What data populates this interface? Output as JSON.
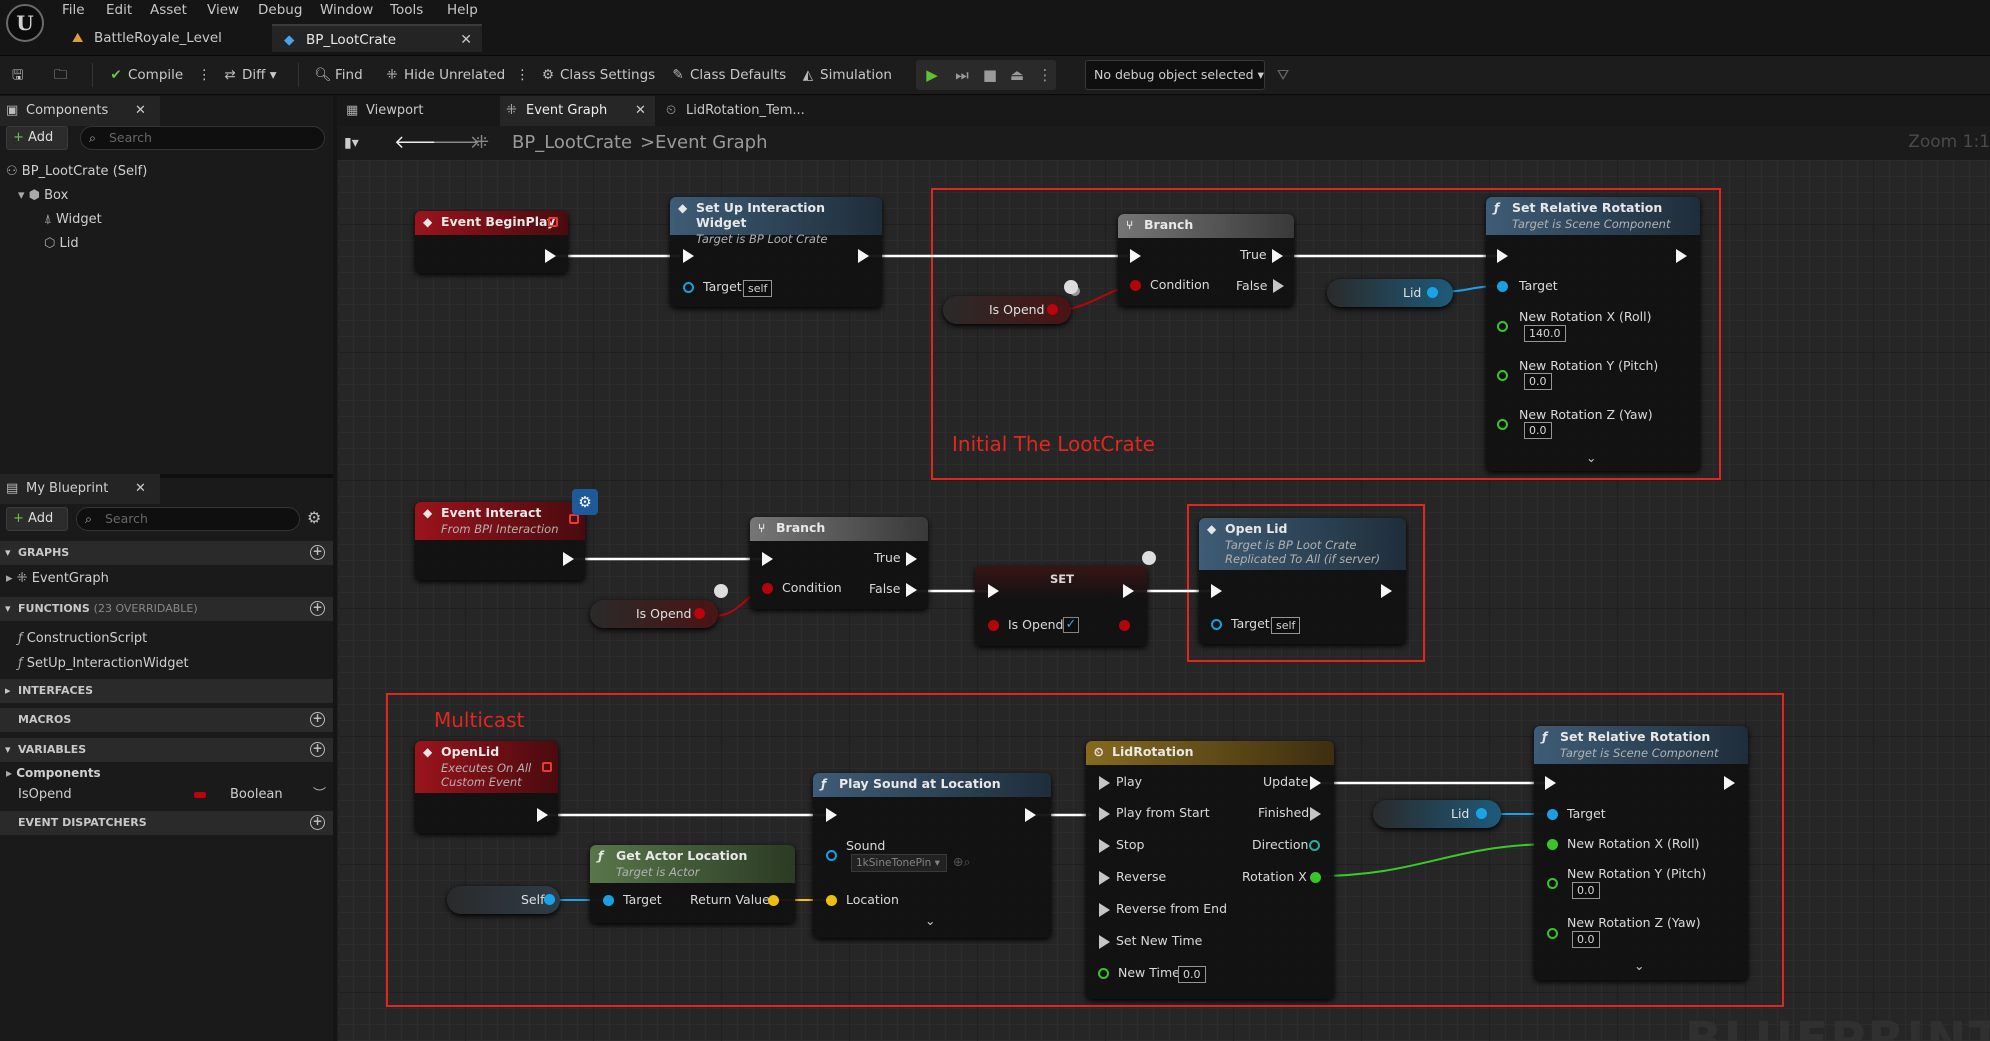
{
  "menu": [
    "File",
    "Edit",
    "Asset",
    "View",
    "Debug",
    "Window",
    "Tools",
    "Help"
  ],
  "doc_tabs": [
    {
      "label": "BattleRoyale_Level"
    },
    {
      "label": "BP_LootCrate"
    }
  ],
  "toolbar": {
    "compile": "Compile",
    "diff": "Diff",
    "find": "Find",
    "hide_unrelated": "Hide Unrelated",
    "class_settings": "Class Settings",
    "class_defaults": "Class Defaults",
    "simulation": "Simulation",
    "debug_select": "No debug object selected"
  },
  "components": {
    "title": "Components",
    "add": "Add",
    "search_placeholder": "Search",
    "items": [
      "BP_LootCrate (Self)",
      "Box",
      "Widget",
      "Lid"
    ]
  },
  "my_blueprint": {
    "title": "My Blueprint",
    "add": "Add",
    "search_placeholder": "Search",
    "sections": {
      "graphs": "GRAPHS",
      "functions": "FUNCTIONS",
      "functions_count": "(23 OVERRIDABLE)",
      "interfaces": "INTERFACES",
      "macros": "MACROS",
      "variables": "VARIABLES",
      "dispatchers": "EVENT DISPATCHERS"
    },
    "graphs": [
      "EventGraph"
    ],
    "functions": [
      "ConstructionScript",
      "SetUp_InteractionWidget"
    ],
    "var_group": "Components",
    "var_name": "IsOpend",
    "var_type": "Boolean"
  },
  "graph_tabs": [
    "Viewport",
    "Event Graph",
    "LidRotation_Tem..."
  ],
  "breadcrumb": {
    "root": "BP_LootCrate",
    "sep": ">",
    "leaf": "Event Graph"
  },
  "zoom": "Zoom 1:1",
  "watermark": "BLUEPRINT",
  "comments": [
    "Initial The LootCrate",
    "Multicast"
  ],
  "nodes": {
    "begin_play": {
      "title": "Event BeginPlay"
    },
    "setup_widget": {
      "title": "Set Up Interaction Widget",
      "sub": "Target is BP Loot Crate",
      "target": "Target",
      "target_val": "self"
    },
    "branch1": {
      "title": "Branch",
      "true": "True",
      "false": "False",
      "cond": "Condition"
    },
    "isopend1": "Is Opend",
    "lid1": "Lid",
    "setrot1": {
      "title": "Set Relative Rotation",
      "sub": "Target is Scene Component",
      "target": "Target",
      "rx": "New Rotation X (Roll)",
      "rx_val": "140.0",
      "ry": "New Rotation Y (Pitch)",
      "ry_val": "0.0",
      "rz": "New Rotation Z (Yaw)",
      "rz_val": "0.0"
    },
    "event_interact": {
      "title": "Event Interact",
      "sub": "From BPI Interaction"
    },
    "branch2": {
      "title": "Branch",
      "true": "True",
      "false": "False",
      "cond": "Condition"
    },
    "isopend2": "Is Opend",
    "set": {
      "title": "SET",
      "pin": "Is Opend"
    },
    "open_lid": {
      "title": "Open Lid",
      "sub": "Target is BP Loot Crate",
      "sub2": "Replicated To All (if server)",
      "target": "Target",
      "target_val": "self"
    },
    "openlid_event": {
      "title": "OpenLid",
      "sub": "Executes On All",
      "sub2": "Custom Event"
    },
    "play_sound": {
      "title": "Play Sound at Location",
      "sound": "Sound",
      "sound_val": "1kSineTonePin",
      "location": "Location"
    },
    "get_actor": {
      "title": "Get Actor Location",
      "sub": "Target is Actor",
      "target": "Target",
      "ret": "Return Value"
    },
    "self": "Self",
    "timeline": {
      "title": "LidRotation",
      "play": "Play",
      "play_start": "Play from Start",
      "stop": "Stop",
      "reverse": "Reverse",
      "reverse_end": "Reverse from End",
      "set_time": "Set New Time",
      "new_time": "New Time",
      "new_time_val": "0.0",
      "update": "Update",
      "finished": "Finished",
      "direction": "Direction",
      "rotx": "Rotation X"
    },
    "lid2": "Lid",
    "setrot2": {
      "title": "Set Relative Rotation",
      "sub": "Target is Scene Component",
      "target": "Target",
      "rx": "New Rotation X (Roll)",
      "ry": "New Rotation Y (Pitch)",
      "ry_val": "0.0",
      "rz": "New Rotation Z (Yaw)",
      "rz_val": "0.0"
    }
  },
  "colors": {
    "exec": "#ffffff",
    "object": "#1aa3e8",
    "bool": "#b8040a",
    "vector": "#f6c410",
    "float": "#3acb2a",
    "comment": "#e0261e"
  }
}
